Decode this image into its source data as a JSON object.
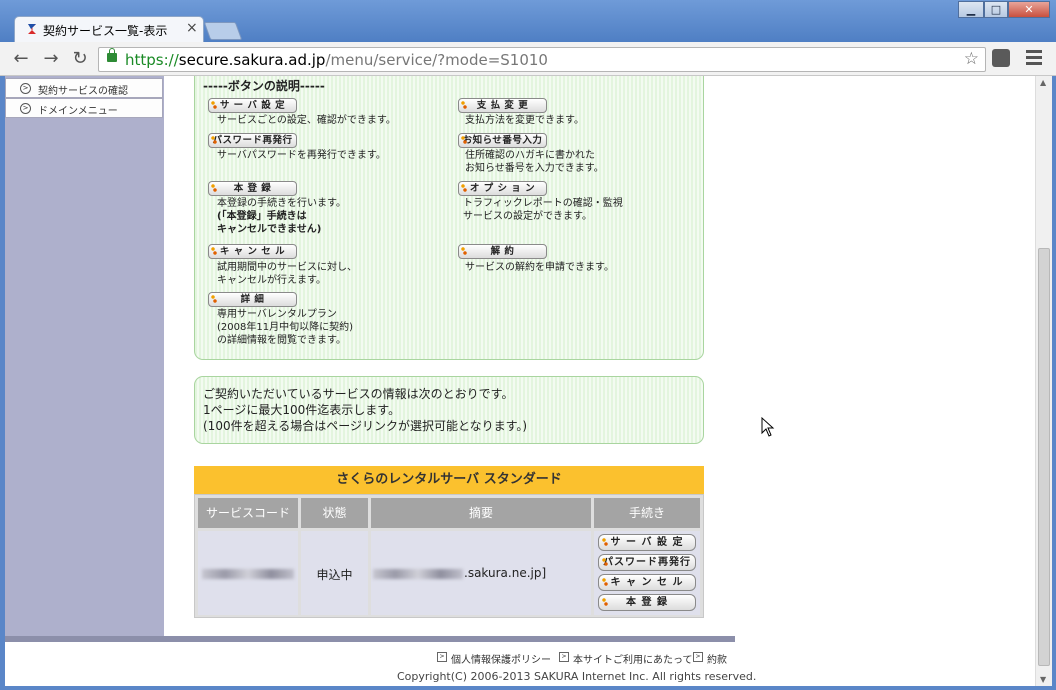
{
  "browser": {
    "tab_title": "契約サービス一覧-表示",
    "tab_close": "×",
    "url_scheme": "https://",
    "url_host": "secure.sakura.ad.jp",
    "url_path": "/menu/service/?mode=S1010",
    "window_minimize": "▁",
    "window_maximize": "□",
    "window_close": "✕",
    "back": "←",
    "forward": "→",
    "reload": "↻",
    "bookmark_star": "☆"
  },
  "sidebar": {
    "items": [
      {
        "label": "契約サービスの確認"
      },
      {
        "label": "ドメインメニュー"
      }
    ]
  },
  "legend": {
    "title": "-----ボタンの説明-----",
    "buttons": [
      {
        "label": "サ ー バ 設 定",
        "desc": [
          "サービスごとの設定、確認ができます。"
        ]
      },
      {
        "label": "支 払 変 更",
        "desc": [
          "支払方法を変更できます。"
        ]
      },
      {
        "label": "パスワード再発行",
        "desc": [
          "サーバパスワードを再発行できます。"
        ]
      },
      {
        "label": "お知らせ番号入力",
        "desc": [
          "住所確認のハガキに書かれた",
          "お知らせ番号を入力できます。"
        ]
      },
      {
        "label": "本 登 録",
        "desc": [
          "本登録の手続きを行います。"
        ],
        "desc_bold": [
          "(「本登録」手続きは",
          "キャンセルできません)"
        ]
      },
      {
        "label": "オ プ シ ョ ン",
        "desc": [
          "トラフィックレポートの確認・監視",
          "サービスの設定ができます。"
        ]
      },
      {
        "label": "キ ャ ン セ ル",
        "desc": [
          "試用期間中のサービスに対し、",
          "キャンセルが行えます。"
        ]
      },
      {
        "label": "解 約",
        "desc": [
          "サービスの解約を申請できます。"
        ]
      },
      {
        "label": "詳 細",
        "desc": [
          "専用サーバレンタルプラン",
          "(2008年11月中旬以降に契約)",
          "の詳細情報を閲覧できます。"
        ]
      }
    ]
  },
  "info": {
    "lines": [
      "ご契約いただいているサービスの情報は次のとおりです。",
      "1ページに最大100件迄表示します。",
      "(100件を超える場合はページリンクが選択可能となります。)"
    ]
  },
  "service": {
    "title": "さくらのレンタルサーバ スタンダード",
    "headers": [
      "サービスコード",
      "状態",
      "摘要",
      "手続き"
    ],
    "row": {
      "status": "申込中",
      "summary_suffix": ".sakura.ne.jp]",
      "actions": [
        "サ ー バ 設 定",
        "パスワード再発行",
        "キ ャ ン セ ル",
        "本 登 録"
      ]
    }
  },
  "footer": {
    "links": [
      "個人情報保護ポリシー",
      "本サイトご利用にあたって",
      "約款"
    ],
    "copyright": "Copyright(C) 2006-2013 SAKURA Internet Inc. All rights reserved."
  },
  "colors": {
    "sidebar_bg": "#aeb0cc",
    "service_title_bg": "#fbc12e",
    "box_border": "#a9d59f",
    "secure_url": "#1a8a25"
  }
}
